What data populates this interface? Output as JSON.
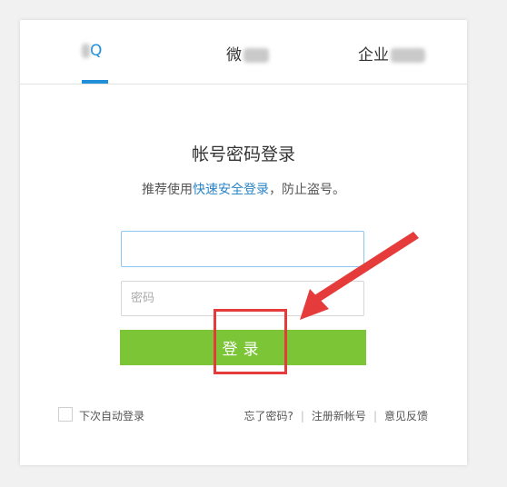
{
  "tabs": [
    {
      "label": "Q"
    },
    {
      "label": "微"
    },
    {
      "label": "企业"
    }
  ],
  "login": {
    "title": "帐号密码登录",
    "subtitle_prefix": "推荐使用",
    "subtitle_link": "快速安全登录",
    "subtitle_suffix": "，防止盗号。",
    "account_placeholder": "",
    "password_placeholder": "密码",
    "button_label": "登录"
  },
  "footer": {
    "remember_label": "下次自动登录",
    "forgot_password": "忘了密码?",
    "register": "注册新帐号",
    "feedback": "意见反馈",
    "separator": "|"
  },
  "colors": {
    "accent_blue": "#1f8fd9",
    "button_green": "#7cc536",
    "annotation_red": "#e63b3b"
  }
}
